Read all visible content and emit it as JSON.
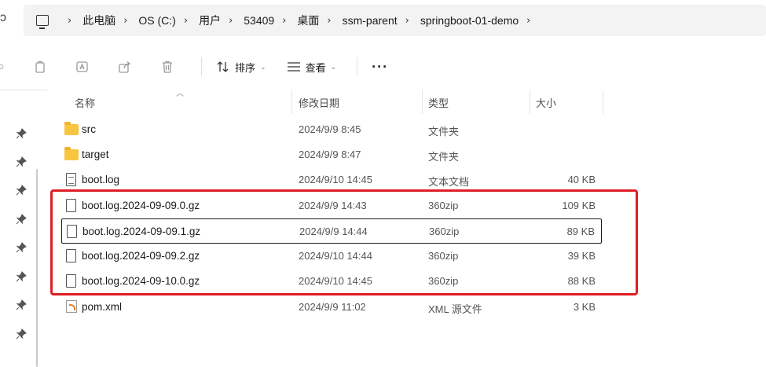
{
  "address": {
    "crumbs": [
      "此电脑",
      "OS (C:)",
      "用户",
      "53409",
      "桌面",
      "ssm-parent",
      "springboot-01-demo"
    ],
    "trailing_separator": "›"
  },
  "toolbar": {
    "sort_label": "排序",
    "view_label": "查看",
    "more_label": "···"
  },
  "columns": {
    "name": "名称",
    "modified": "修改日期",
    "type": "类型",
    "size": "大小"
  },
  "files": [
    {
      "name": "src",
      "modified": "2024/9/9 8:45",
      "type": "文件夹",
      "size": "",
      "icon": "folder-icon"
    },
    {
      "name": "target",
      "modified": "2024/9/9 8:47",
      "type": "文件夹",
      "size": "",
      "icon": "folder-icon"
    },
    {
      "name": "boot.log",
      "modified": "2024/9/10 14:45",
      "type": "文本文档",
      "size": "40 KB",
      "icon": "text-file-icon"
    },
    {
      "name": "boot.log.2024-09-09.0.gz",
      "modified": "2024/9/9 14:43",
      "type": "360zip",
      "size": "109 KB",
      "icon": "file-icon"
    },
    {
      "name": "boot.log.2024-09-09.1.gz",
      "modified": "2024/9/9 14:44",
      "type": "360zip",
      "size": "89 KB",
      "icon": "file-icon"
    },
    {
      "name": "boot.log.2024-09-09.2.gz",
      "modified": "2024/9/10 14:44",
      "type": "360zip",
      "size": "39 KB",
      "icon": "file-icon"
    },
    {
      "name": "boot.log.2024-09-10.0.gz",
      "modified": "2024/9/10 14:45",
      "type": "360zip",
      "size": "88 KB",
      "icon": "file-icon"
    },
    {
      "name": "pom.xml",
      "modified": "2024/9/9 11:02",
      "type": "XML 源文件",
      "size": "3 KB",
      "icon": "xml-file-icon"
    }
  ],
  "colors": {
    "highlight": "#e01e26",
    "folder": "#f8c542"
  }
}
